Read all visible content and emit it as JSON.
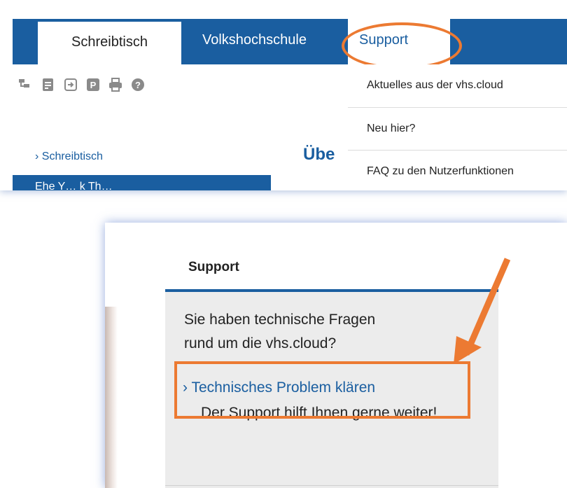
{
  "top": {
    "tabs": [
      "Schreibtisch",
      "Volkshochschule",
      "Support"
    ],
    "dropdown": [
      "Aktuelles aus der vhs.cloud",
      "Neu hier?",
      "FAQ zu den Nutzerfunktionen"
    ],
    "sidebar_link": "Schreibtisch",
    "sidebar_bar_partial": "Ehe Y… k Th…",
    "heading_partial": "Übe",
    "toolbar_icons": [
      "hierarchy-icon",
      "note-icon",
      "login-icon",
      "parking-icon",
      "print-icon",
      "help-icon"
    ]
  },
  "bottom": {
    "title": "Support",
    "text": "Sie haben technische Fragen rund um die vhs.cloud?",
    "link": "Technisches Problem klären",
    "sub": "Der Support hilft Ihnen gerne weiter!"
  },
  "colors": {
    "primary": "#1a5ea0",
    "highlight": "#ec7a32",
    "panel": "#ececec"
  }
}
